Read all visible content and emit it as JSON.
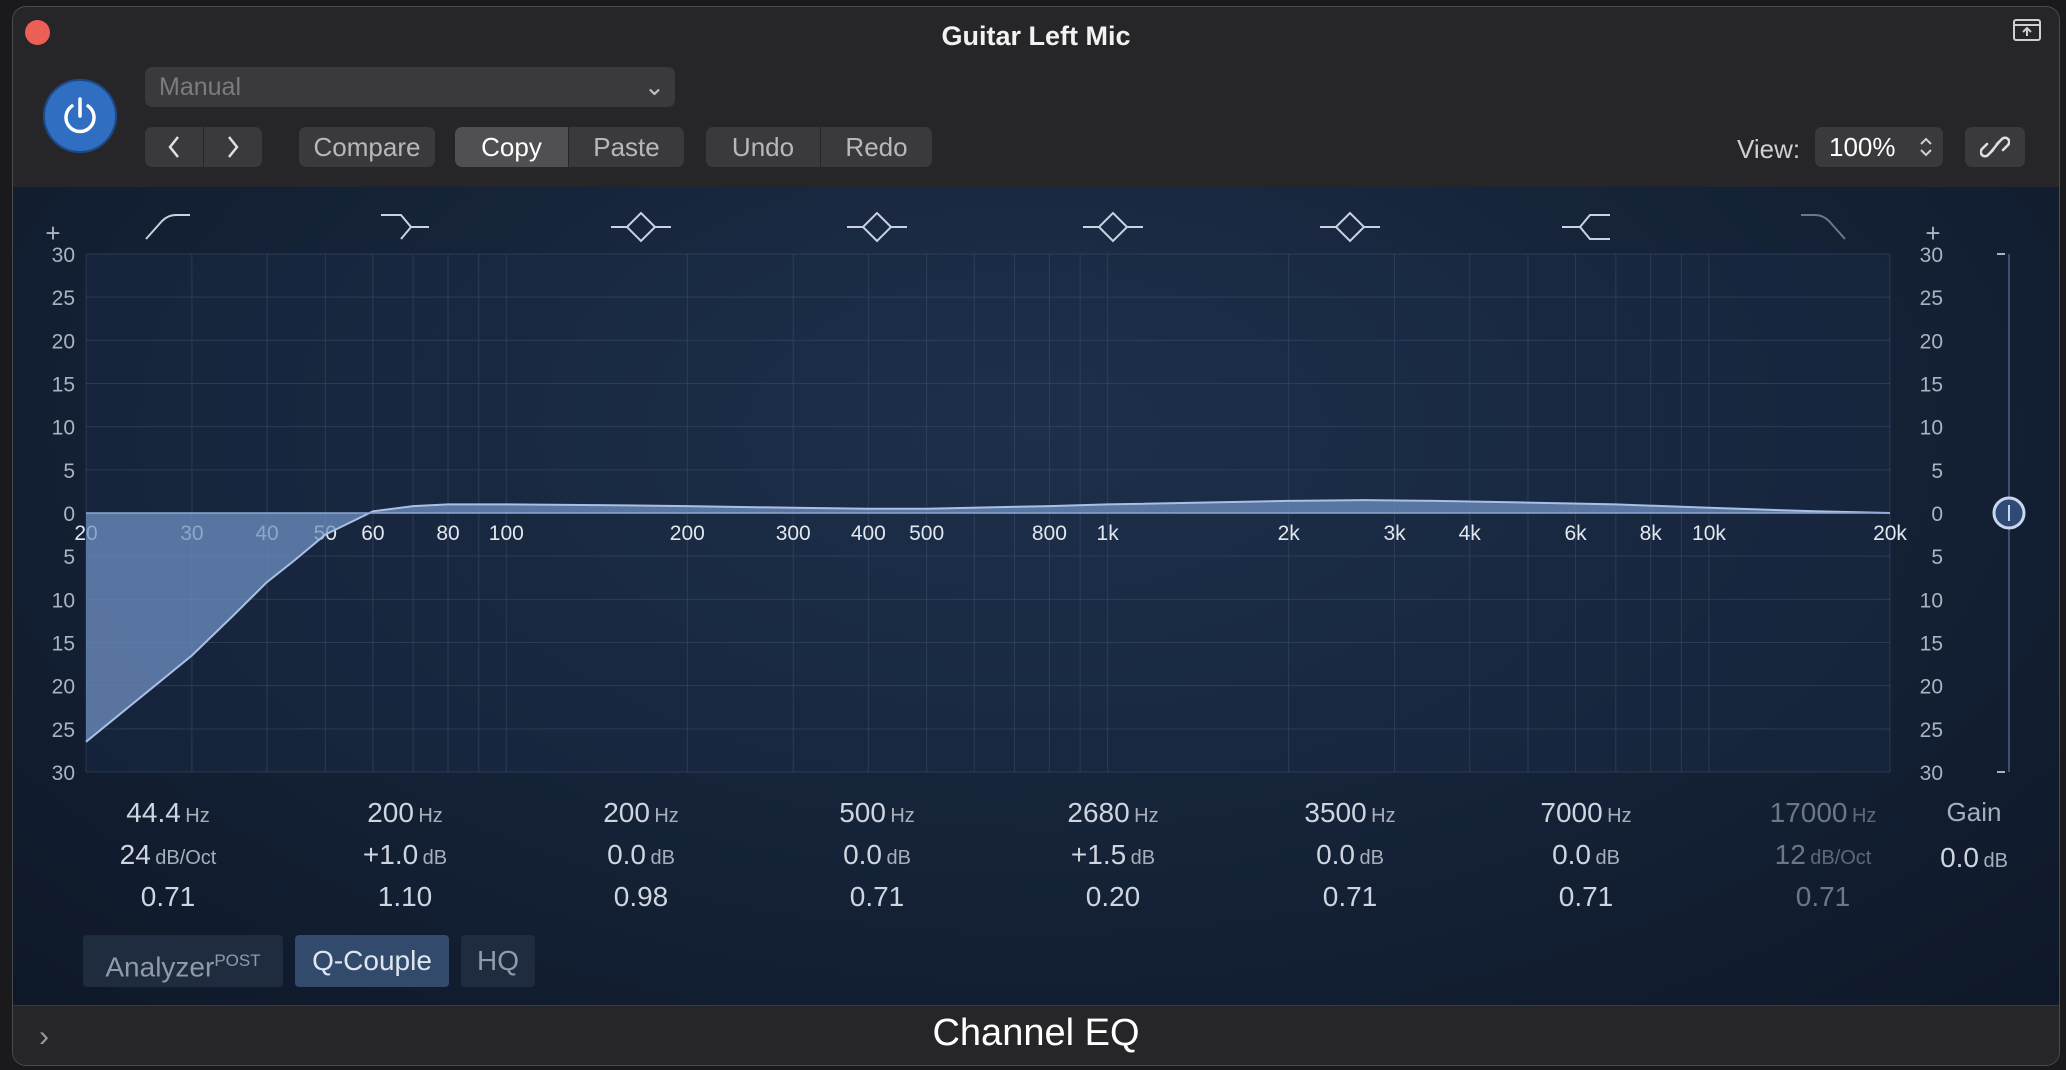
{
  "window": {
    "title": "Guitar Left Mic"
  },
  "toolbar": {
    "preset": "Manual",
    "compare": "Compare",
    "copy": "Copy",
    "paste": "Paste",
    "undo": "Undo",
    "redo": "Redo",
    "view_label": "View:",
    "view_value": "100%"
  },
  "graph": {
    "gain_ticks": [
      "30",
      "25",
      "20",
      "15",
      "10",
      "5",
      "0",
      "5",
      "10",
      "15",
      "20",
      "25",
      "30"
    ],
    "freq_labels": [
      {
        "hz": 20,
        "label": "20"
      },
      {
        "hz": 30,
        "label": "30"
      },
      {
        "hz": 40,
        "label": "40"
      },
      {
        "hz": 50,
        "label": "50"
      },
      {
        "hz": 60,
        "label": "60"
      },
      {
        "hz": 80,
        "label": "80"
      },
      {
        "hz": 100,
        "label": "100"
      },
      {
        "hz": 200,
        "label": "200"
      },
      {
        "hz": 300,
        "label": "300"
      },
      {
        "hz": 400,
        "label": "400"
      },
      {
        "hz": 500,
        "label": "500"
      },
      {
        "hz": 800,
        "label": "800"
      },
      {
        "hz": 1000,
        "label": "1k"
      },
      {
        "hz": 2000,
        "label": "2k"
      },
      {
        "hz": 3000,
        "label": "3k"
      },
      {
        "hz": 4000,
        "label": "4k"
      },
      {
        "hz": 6000,
        "label": "6k"
      },
      {
        "hz": 8000,
        "label": "8k"
      },
      {
        "hz": 10000,
        "label": "10k"
      },
      {
        "hz": 20000,
        "label": "20k"
      }
    ],
    "band_icons": [
      "low-cut-icon",
      "low-shelf-icon",
      "peak-icon",
      "peak-icon",
      "peak-icon",
      "peak-icon",
      "high-shelf-icon",
      "high-cut-icon"
    ],
    "bands_enabled": [
      true,
      true,
      true,
      true,
      true,
      true,
      true,
      false
    ],
    "curve_db_points": [
      [
        20,
        -26.5
      ],
      [
        25,
        -21
      ],
      [
        30,
        -16.5
      ],
      [
        35,
        -12
      ],
      [
        40,
        -8
      ],
      [
        44.4,
        -5.5
      ],
      [
        50,
        -2.5
      ],
      [
        60,
        0.2
      ],
      [
        70,
        0.8
      ],
      [
        80,
        1.0
      ],
      [
        100,
        1.0
      ],
      [
        150,
        0.9
      ],
      [
        200,
        0.8
      ],
      [
        300,
        0.6
      ],
      [
        400,
        0.5
      ],
      [
        500,
        0.5
      ],
      [
        800,
        0.8
      ],
      [
        1000,
        1.0
      ],
      [
        2000,
        1.4
      ],
      [
        2680,
        1.5
      ],
      [
        3500,
        1.4
      ],
      [
        5000,
        1.2
      ],
      [
        7000,
        1.0
      ],
      [
        10000,
        0.6
      ],
      [
        15000,
        0.2
      ],
      [
        20000,
        0.0
      ]
    ],
    "gain_slider": {
      "labels": [
        "+",
        "30",
        "25",
        "20",
        "15",
        "10",
        "5",
        "0",
        "5",
        "10",
        "15",
        "20",
        "25",
        "30"
      ],
      "value_db": 0.0
    }
  },
  "bands": [
    {
      "freq": "44.4",
      "freq_unit": "Hz",
      "gain": "24",
      "gain_unit": "dB/Oct",
      "q": "0.71",
      "enabled": true
    },
    {
      "freq": "200",
      "freq_unit": "Hz",
      "gain": "+1.0",
      "gain_unit": "dB",
      "q": "1.10",
      "enabled": true
    },
    {
      "freq": "200",
      "freq_unit": "Hz",
      "gain": "0.0",
      "gain_unit": "dB",
      "q": "0.98",
      "enabled": true
    },
    {
      "freq": "500",
      "freq_unit": "Hz",
      "gain": "0.0",
      "gain_unit": "dB",
      "q": "0.71",
      "enabled": true
    },
    {
      "freq": "2680",
      "freq_unit": "Hz",
      "gain": "+1.5",
      "gain_unit": "dB",
      "q": "0.20",
      "enabled": true
    },
    {
      "freq": "3500",
      "freq_unit": "Hz",
      "gain": "0.0",
      "gain_unit": "dB",
      "q": "0.71",
      "enabled": true
    },
    {
      "freq": "7000",
      "freq_unit": "Hz",
      "gain": "0.0",
      "gain_unit": "dB",
      "q": "0.71",
      "enabled": true
    },
    {
      "freq": "17000",
      "freq_unit": "Hz",
      "gain": "12",
      "gain_unit": "dB/Oct",
      "q": "0.71",
      "enabled": false
    }
  ],
  "master_gain": {
    "label": "Gain",
    "value": "0.0",
    "unit": "dB"
  },
  "toggles": {
    "analyzer": "Analyzer",
    "analyzer_sup": "POST",
    "qcouple": "Q-Couple",
    "hq": "HQ"
  },
  "footer": {
    "plugin_name": "Channel EQ"
  },
  "colors": {
    "accent": "#2f6ec0",
    "curve_fill": "#6f8fc2",
    "curve_line": "#a9c0e6"
  }
}
